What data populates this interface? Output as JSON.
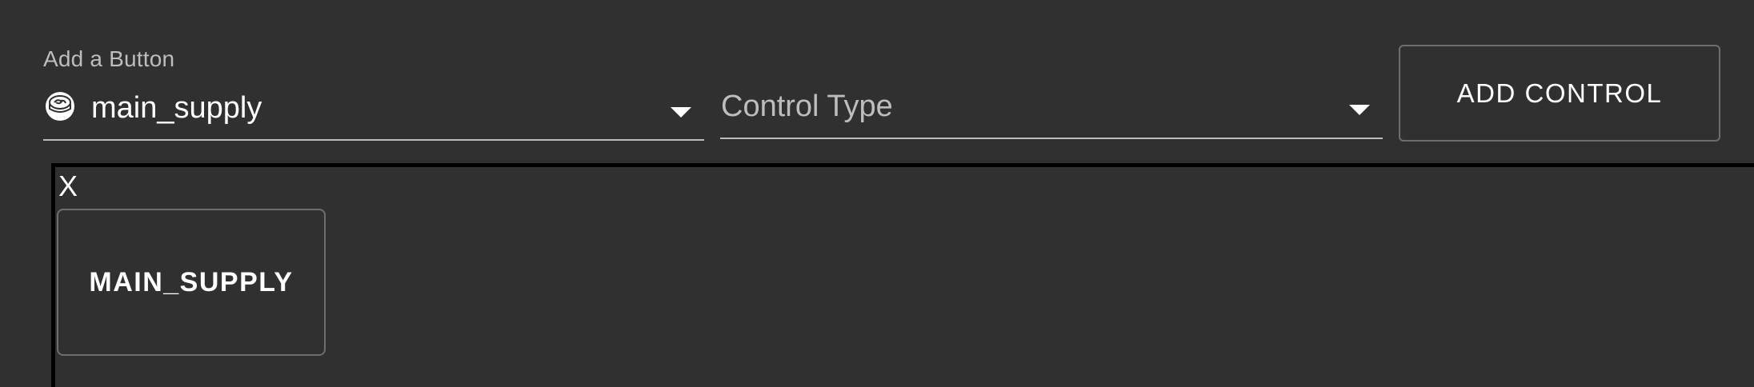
{
  "button_select": {
    "label": "Add a Button",
    "value": "main_supply",
    "icon": "button-icon"
  },
  "control_type_select": {
    "placeholder": "Control Type"
  },
  "add_control": {
    "label": "ADD CONTROL"
  },
  "canvas": {
    "close_label": "X",
    "controls": [
      {
        "label": "MAIN_SUPPLY"
      }
    ]
  },
  "colors": {
    "background": "#303030",
    "text": "#ffffff",
    "muted_text": "#bdbdbd",
    "border": "#6e6e6e",
    "canvas_border": "#000000"
  }
}
